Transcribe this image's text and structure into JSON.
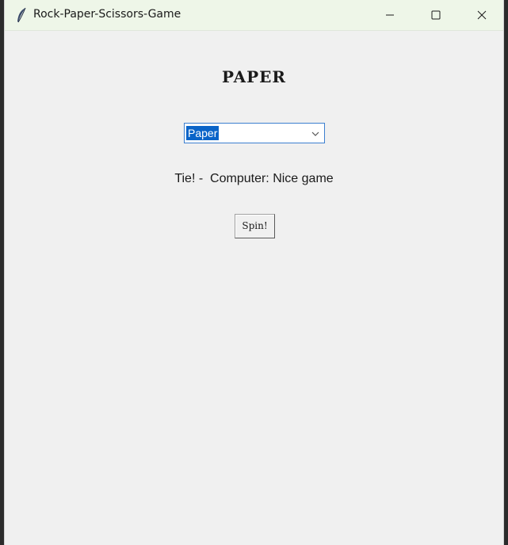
{
  "window": {
    "title": "Rock-Paper-Scissors-Game",
    "icon": "feather-icon",
    "controls": [
      "minimize-icon",
      "maximize-icon",
      "close-icon"
    ]
  },
  "main": {
    "heading": "PAPER",
    "choice_select": {
      "selected": "Paper"
    },
    "result_text": "Tie! -  Computer: Nice game",
    "spin_label": "Spin!"
  },
  "colors": {
    "window_bg": "#f0f0f0",
    "titlebar_bg": "#eef6e8",
    "selection": "#0a64c8",
    "focus_border": "#3c7fd0"
  }
}
